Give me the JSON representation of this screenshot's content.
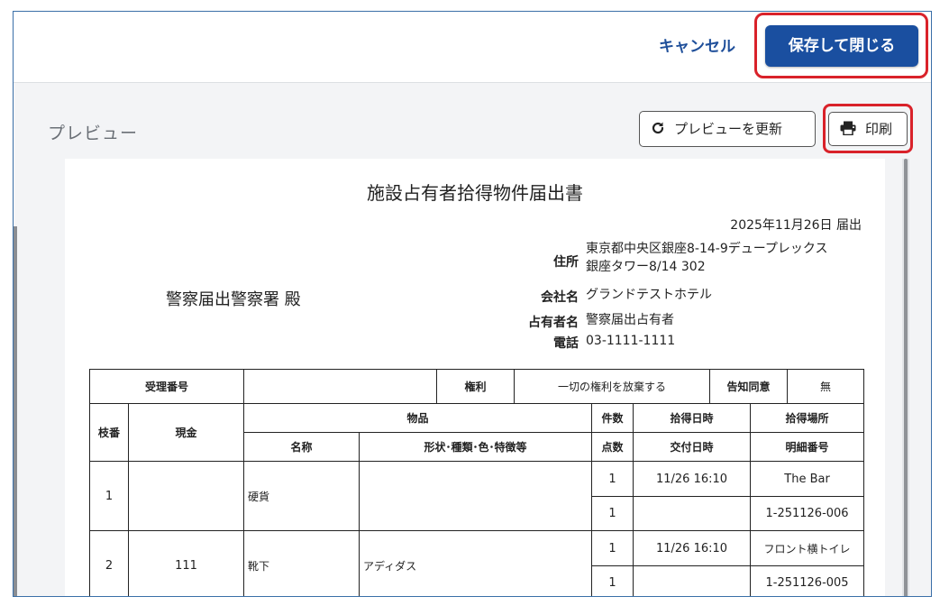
{
  "header": {
    "cancel_label": "キャンセル",
    "save_close_label": "保存して閉じる"
  },
  "preview": {
    "label": "プレビュー",
    "refresh_label": "プレビューを更新",
    "print_label": "印刷"
  },
  "document": {
    "title": "施設占有者拾得物件届出書",
    "date": "2025年11月26日 届出",
    "recipient": "警察届出警察署 殿",
    "address_label": "住所",
    "address_line1": "東京都中央区銀座8-14-9デュープレックス",
    "address_line2": "銀座タワー8/14 302",
    "company_label": "会社名",
    "company": "グランドテストホテル",
    "occupant_label": "占有者名",
    "occupant": "警察届出占有者",
    "phone_label": "電話",
    "phone": "03-1111-1111"
  },
  "table": {
    "receipt_no_label": "受理番号",
    "receipt_no": "",
    "rights_label": "権利",
    "rights_value": "一切の権利を放棄する",
    "consent_label": "告知同意",
    "consent_value": "無",
    "h_branch": "枝番",
    "h_cash": "現金",
    "h_item": "物品",
    "h_count": "件数",
    "h_found_datetime": "拾得日時",
    "h_found_place": "拾得場所",
    "h_name": "名称",
    "h_desc": "形状･種類･色･特徴等",
    "h_points": "点数",
    "h_delivery_datetime": "交付日時",
    "h_detail_no": "明細番号",
    "rows": [
      {
        "branch": "1",
        "cash": "",
        "name": "硬貨",
        "desc": "",
        "count": "1",
        "found_datetime": "11/26 16:10",
        "place": "The Bar",
        "points": "1",
        "delivery_datetime": "",
        "detail_no": "1-251126-006"
      },
      {
        "branch": "2",
        "cash": "111",
        "name": "靴下",
        "desc": "アディダス",
        "count": "1",
        "found_datetime": "11/26 16:10",
        "place": "フロント横トイレ",
        "points": "1",
        "delivery_datetime": "",
        "detail_no": "1-251126-005"
      }
    ]
  },
  "colors": {
    "primary": "#1a4fa0",
    "highlight": "#d9222a",
    "cancel_text": "#1f4f9a"
  },
  "icons": [
    "refresh-icon",
    "printer-icon"
  ]
}
